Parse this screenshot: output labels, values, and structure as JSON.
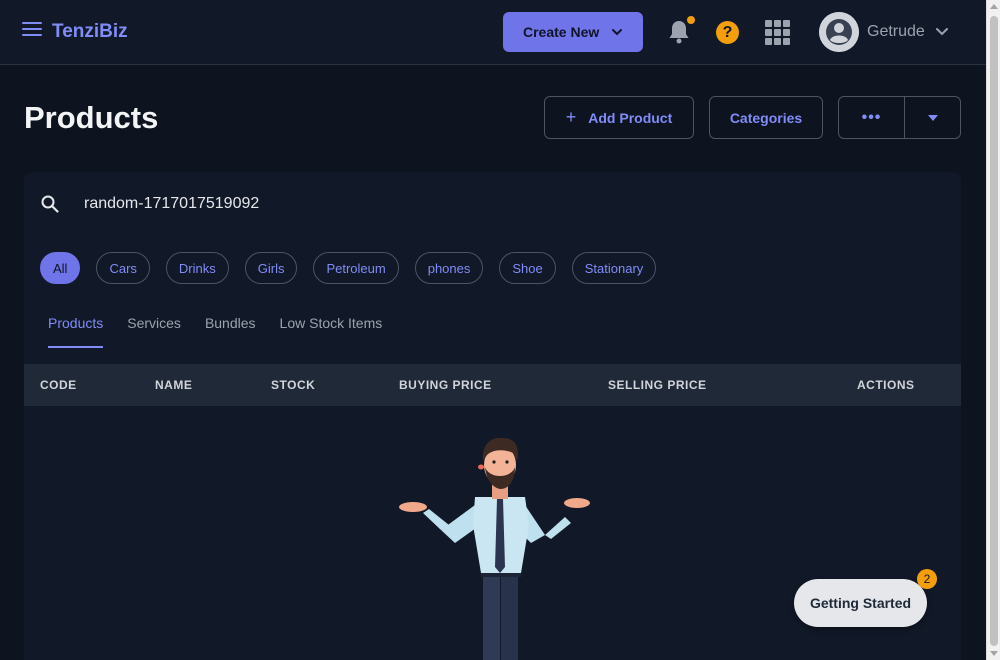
{
  "app": {
    "brand": "TenziBiz"
  },
  "header": {
    "create_label": "Create New",
    "help_glyph": "?",
    "user_name": "Getrude",
    "notification_dot_color": "#f59e0b"
  },
  "page": {
    "title": "Products",
    "add_product_label": "Add Product",
    "categories_label": "Categories",
    "more_label": "•••"
  },
  "search": {
    "value": "random-1717017519092"
  },
  "categories": [
    "All",
    "Cars",
    "Drinks",
    "Girls",
    "Petroleum",
    "phones",
    "Shoe",
    "Stationary"
  ],
  "tabs": [
    "Products",
    "Services",
    "Bundles",
    "Low Stock Items"
  ],
  "table": {
    "columns": [
      "CODE",
      "NAME",
      "STOCK",
      "BUYING PRICE",
      "SELLING PRICE",
      "ACTIONS"
    ]
  },
  "getting_started": {
    "label": "Getting Started",
    "badge": "2"
  },
  "colors": {
    "accent": "#818cf8",
    "primary_button": "#6f74e8",
    "warning": "#f59e0b"
  }
}
